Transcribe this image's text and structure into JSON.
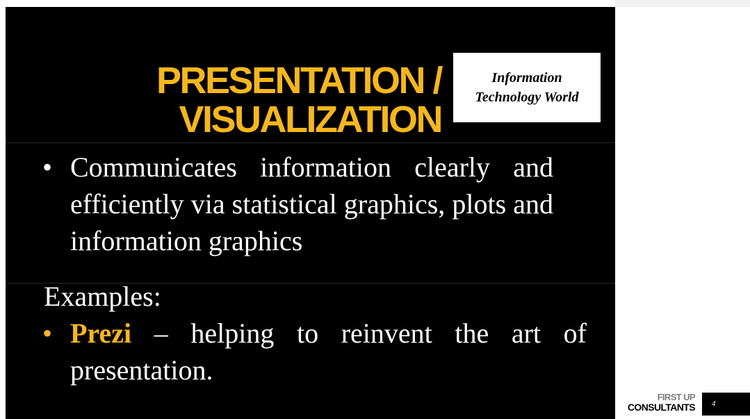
{
  "slide": {
    "title_lines": [
      "PRESENTATION /",
      "VISUALIZATION"
    ],
    "badge_lines": [
      "Information",
      "Technology World"
    ],
    "bullets": [
      {
        "text": "Communicates information clearly and efficiently via statistical graphics, plots and information graphics"
      }
    ],
    "examples_label": "Examples:",
    "example_bullet": {
      "highlight": "Prezi",
      "text": " – helping to reinvent the art of presentation."
    },
    "bullet_symbol": "•"
  },
  "footer": {
    "brand_top": "FIRST UP",
    "brand_bottom": "CONSULTANTS",
    "page_number": "4"
  },
  "colors": {
    "accent": "#f6b71c",
    "slide_background": "#000000",
    "text": "#ffffff"
  }
}
